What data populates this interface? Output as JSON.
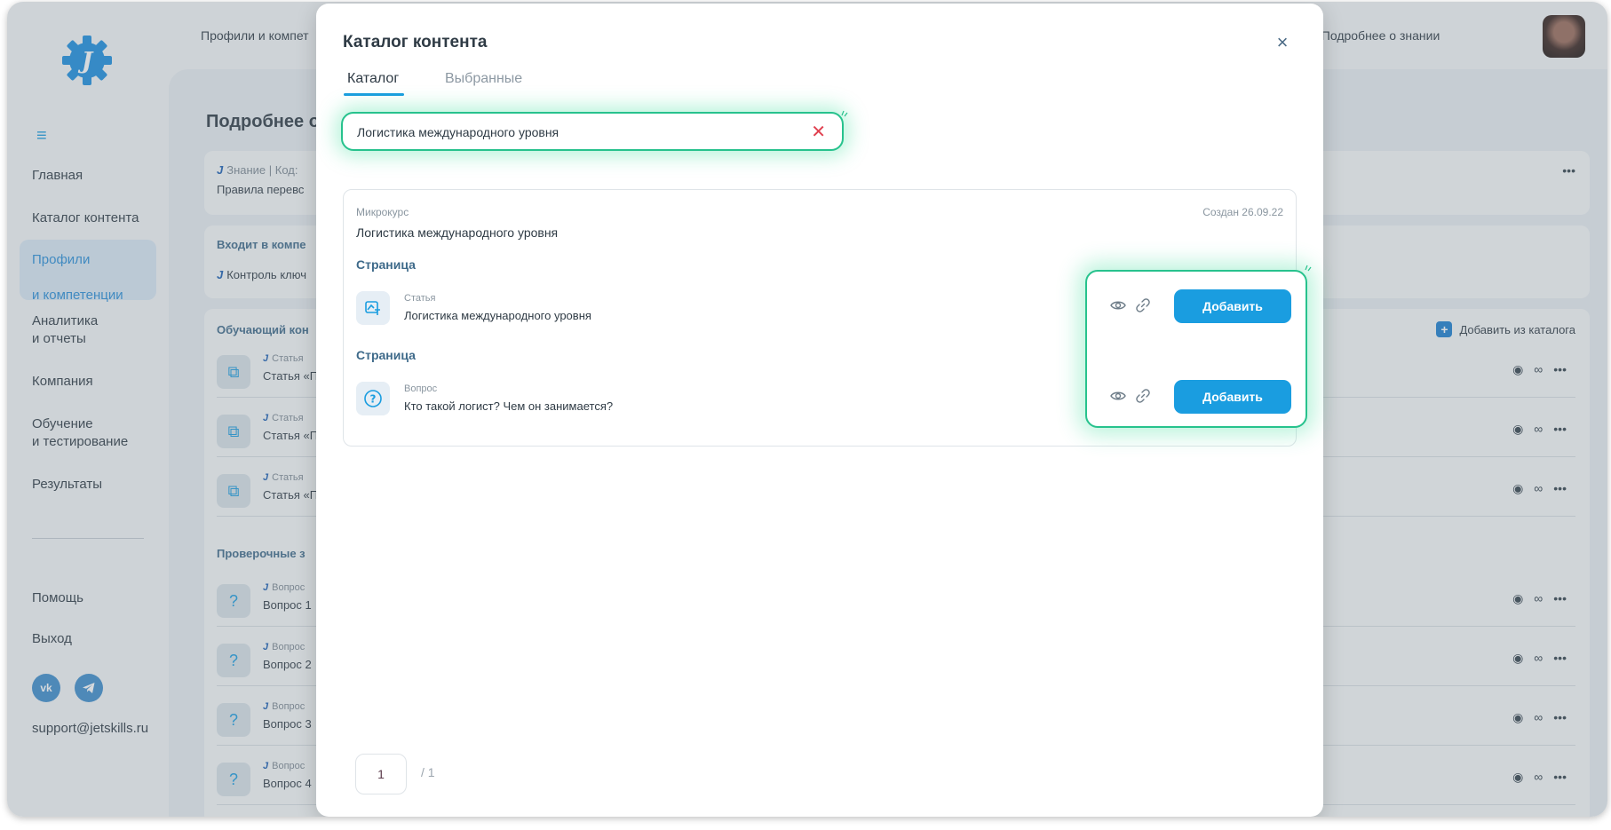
{
  "breadcrumb": {
    "left": "Профили и компет",
    "right": "/ Подробнее о знании"
  },
  "sidebar": {
    "items": [
      {
        "label": "Главная"
      },
      {
        "label": "Каталог контента"
      },
      {
        "label_line1": "Профили",
        "label_line2": "и компетенции"
      },
      {
        "label_line1": "Аналитика",
        "label_line2": "и отчеты"
      },
      {
        "label": "Компания"
      },
      {
        "label_line1": "Обучение",
        "label_line2": "и тестирование"
      },
      {
        "label": "Результаты"
      }
    ],
    "help": "Помощь",
    "exit": "Выход",
    "social_vk": "vk",
    "support_email": "support@jetskills.ru"
  },
  "main": {
    "title": "Подробнее о",
    "knowledge_meta": "Знание | Код:",
    "knowledge_desc": "Правила перевс",
    "included_label": "Входит в компе",
    "included_item": "Контроль ключ",
    "learning_label": "Обучающий кон",
    "add_from_catalog": "Добавить из каталога",
    "learning_rows": [
      {
        "type": "Статья",
        "name": "Статья «П"
      },
      {
        "type": "Статья",
        "name": "Статья «П"
      },
      {
        "type": "Статья",
        "name": "Статья «П"
      }
    ],
    "check_label": "Проверочные з",
    "check_rows": [
      {
        "type": "Вопрос",
        "name": "Вопрос 1"
      },
      {
        "type": "Вопрос",
        "name": "Вопрос 2"
      },
      {
        "type": "Вопрос",
        "name": "Вопрос 3"
      },
      {
        "type": "Вопрос",
        "name": "Вопрос 4"
      }
    ],
    "more": "•••"
  },
  "modal": {
    "title": "Каталог контента",
    "close": "×",
    "tabs": [
      {
        "label": "Каталог",
        "active": true
      },
      {
        "label": "Выбранные",
        "active": false
      }
    ],
    "search": {
      "value": "Логистика международного уровня",
      "clear": "✕"
    },
    "result": {
      "type": "Микрокурс",
      "date": "Создан 26.09.22",
      "title": "Логистика международного уровня",
      "pages": [
        {
          "section": "Страница",
          "item_type": "Статья",
          "item_name": "Логистика международного уровня",
          "add_label": "Добавить"
        },
        {
          "section": "Страница",
          "item_type": "Вопрос",
          "item_name": "Кто такой логист? Чем он занимается?",
          "add_label": "Добавить"
        }
      ]
    },
    "pagination": {
      "current": "1",
      "total": "/ 1"
    }
  },
  "colors": {
    "accent": "#1a9de0",
    "highlight": "#27c28d",
    "danger": "#e0404f"
  }
}
